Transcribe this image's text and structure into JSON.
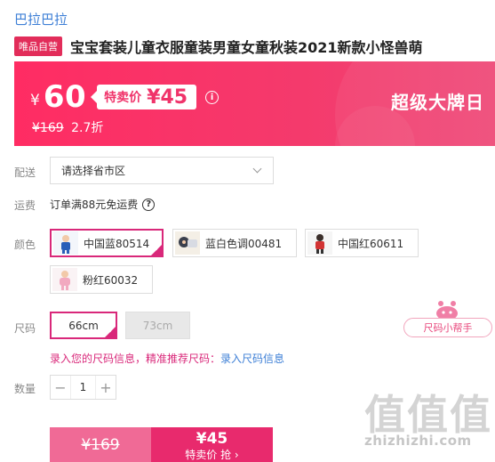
{
  "brand": "巴拉巴拉",
  "badge": "唯品自营",
  "title": "宝宝套装儿童衣服童装男童女童秋装2021新款小怪兽萌",
  "banner": {
    "yen": "¥",
    "price": "60",
    "special_label": "特卖价",
    "special_price": "¥45",
    "info_icon": "i",
    "original_price": "¥169",
    "discount": "2.7折",
    "event": "超级大牌日"
  },
  "labels": {
    "delivery": "配送",
    "shipping": "运费",
    "color": "颜色",
    "size": "尺码",
    "quantity": "数量"
  },
  "region_select": {
    "value": "请选择省市区",
    "icon": "chevron-down-icon"
  },
  "shipping_text": "订单满88元免运费",
  "help_icon": "?",
  "colors": [
    {
      "label": "中国蓝80514",
      "selected": true
    },
    {
      "label": "蓝白色调00481",
      "selected": false
    },
    {
      "label": "中国红60611",
      "selected": false
    },
    {
      "label": "粉红60032",
      "selected": false
    }
  ],
  "sizes": [
    {
      "label": "66cm",
      "selected": true,
      "available": true
    },
    {
      "label": "73cm",
      "selected": false,
      "available": false
    }
  ],
  "size_helper": "尺码小帮手",
  "size_info": {
    "prompt": "录入您的尺码信息，精准推荐尺码：",
    "link": "录入尺码信息"
  },
  "quantity": {
    "minus": "−",
    "value": "1",
    "plus": "+"
  },
  "buy_bar": {
    "original": "¥169",
    "special_price": "¥45",
    "special_action": "特卖价 抢 ›"
  },
  "watermark": {
    "chars": "值值值",
    "url": "zhizhizhi.com"
  },
  "colors_theme": {
    "accent": "#e82a6d",
    "link": "#3d7fd6",
    "select": "#d9287a"
  }
}
